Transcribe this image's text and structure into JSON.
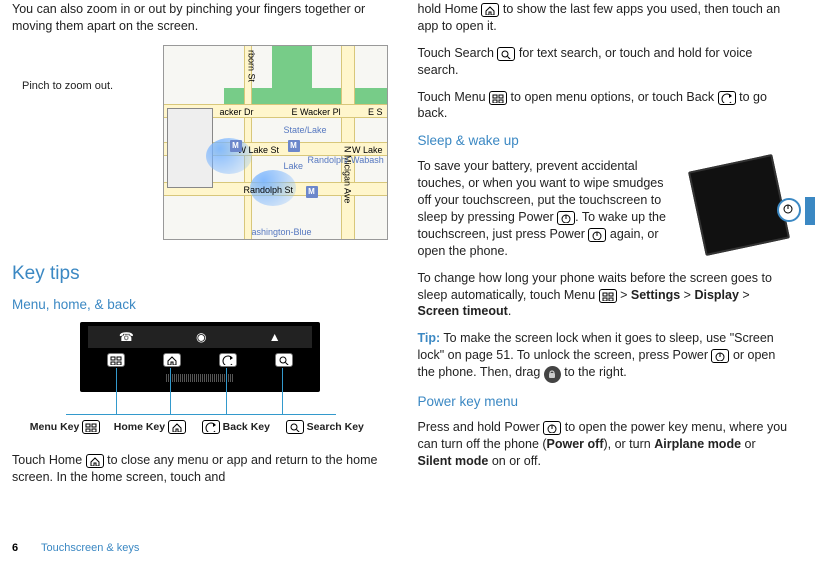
{
  "left": {
    "intro": "You can also zoom in or out by pinching your fingers together or moving them apart on the screen.",
    "map_caption": "Pinch to zoom out.",
    "map": {
      "streets_v": [
        "rborn St",
        "N Micigan Ave"
      ],
      "streets_h": [
        "acker Dr",
        "E Wacker Pl",
        "E S",
        "W Lake St",
        "W Lake",
        "Randolph St"
      ],
      "stations": [
        "State/Lake",
        "Lake",
        "Randolph/ Wabash",
        "ashington-Blue"
      ],
      "marker": "M"
    },
    "h1": "Key tips",
    "h2": "Menu, home, & back",
    "key_labels": {
      "menu": "Menu Key",
      "home": "Home Key",
      "back": "Back Key",
      "search": "Search Key"
    },
    "p_home_1a": "Touch Home ",
    "p_home_1b": " to close any menu or app and return to the home screen. In the home screen, touch and "
  },
  "right": {
    "p_home_2a": "hold Home ",
    "p_home_2b": " to show the last few apps you used, then touch an app to open it.",
    "p_search_a": "Touch Search ",
    "p_search_b": " for text search, or touch and hold for voice search.",
    "p_menu_a": "Touch Menu ",
    "p_menu_b": " to open menu options, or touch Back ",
    "p_menu_c": " to go back.",
    "h2_sleep": "Sleep & wake up",
    "p_sleep_a": "To save your battery, prevent accidental touches, or when you want to wipe smudges off your touchscreen, put the touchscreen to sleep by pressing Power ",
    "p_sleep_b": ". To wake up the touchscreen, just press Power ",
    "p_sleep_c": " again, or open the phone.",
    "p_timeout_a": "To change how long your phone waits before the screen goes to sleep automatically, touch Menu ",
    "p_timeout_b": " > ",
    "p_timeout_settings": "Settings",
    "p_timeout_display": "Display",
    "p_timeout_screen": "Screen timeout",
    "p_timeout_dot": ".",
    "tip_label": "Tip:",
    "p_tip_a": " To make the screen lock when it goes to sleep, use \"Screen lock\" on page 51. To unlock the screen, press Power ",
    "p_tip_b": " or open the phone. Then, drag ",
    "p_tip_c": " to the right.",
    "h2_power": "Power key menu",
    "p_power_a": "Press and hold Power ",
    "p_power_b": " to open the power key menu, where you can turn off the phone (",
    "p_power_off": "Power off",
    "p_power_c": "), or turn ",
    "p_power_air": "Airplane mode",
    "p_power_d": " or ",
    "p_power_silent": "Silent mode",
    "p_power_e": " on or off."
  },
  "footer": {
    "page": "6",
    "section": "Touchscreen & keys"
  },
  "icons": {
    "home": "home-icon",
    "search": "search-icon",
    "menu": "menu-icon",
    "back": "back-icon",
    "power": "power-icon",
    "unlock": "unlock-icon"
  }
}
